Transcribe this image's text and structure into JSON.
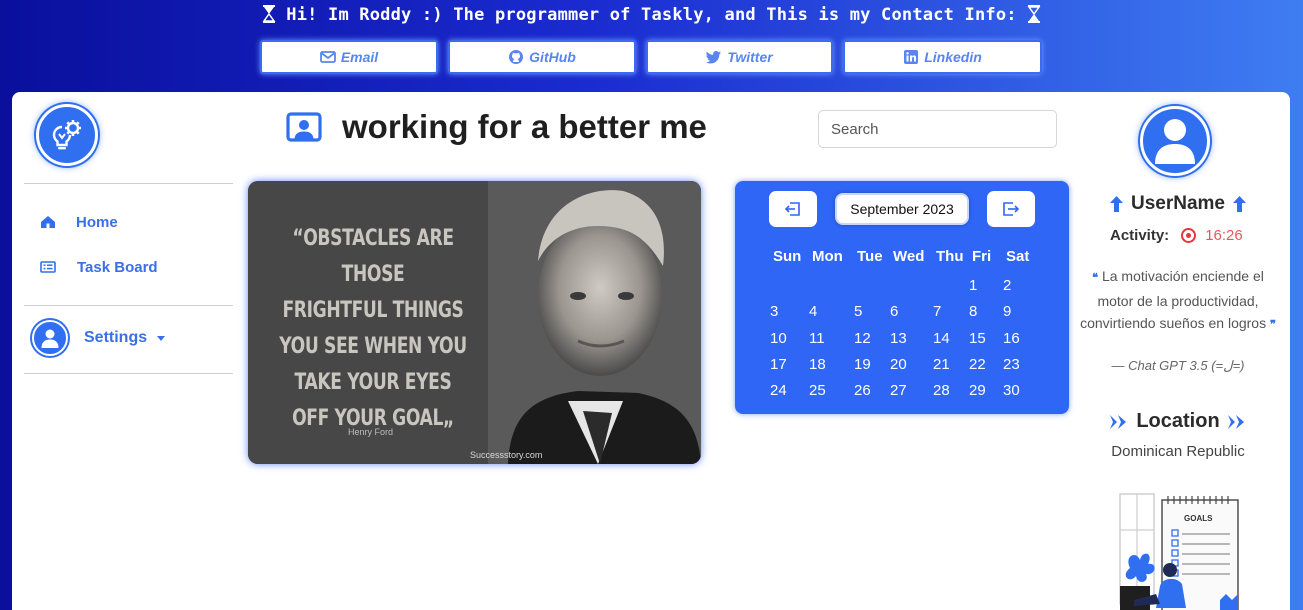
{
  "banner": {
    "title": "Hi! Im Roddy :) The programmer of Taskly, and This is my Contact Info:",
    "contacts": [
      {
        "label": "Email",
        "icon": "envelope-icon"
      },
      {
        "label": "GitHub",
        "icon": "github-icon"
      },
      {
        "label": "Twitter",
        "icon": "twitter-icon"
      },
      {
        "label": "Linkedin",
        "icon": "linkedin-icon"
      }
    ]
  },
  "sidebar": {
    "logo_icon": "lightbulb-gear-icon",
    "items": [
      {
        "label": "Home",
        "icon": "home-icon"
      },
      {
        "label": "Task Board",
        "icon": "board-icon"
      }
    ],
    "settings_label": "Settings"
  },
  "header": {
    "title": "working for a better me",
    "title_icon": "user-presentation-icon",
    "search_placeholder": "Search"
  },
  "quote_image": {
    "lines": [
      "OBSTACLES ARE THOSE",
      "FRIGHTFUL THINGS",
      "YOU SEE WHEN YOU",
      "TAKE YOUR EYES",
      "OFF YOUR GOAL"
    ],
    "open_mark": "“",
    "close_mark": "„",
    "author": "Henry Ford",
    "site": "Successstory.com"
  },
  "calendar": {
    "month_label": "September 2023",
    "prev_icon": "arrow-left-exit-icon",
    "next_icon": "arrow-right-exit-icon",
    "weekdays": [
      "Sun",
      "Mon",
      "Tue",
      "Wed",
      "Thu",
      "Fri",
      "Sat"
    ],
    "first_weekday_index": 5,
    "days_in_month": 30
  },
  "profile": {
    "username": "UserName",
    "activity_label": "Activity:",
    "timer": "16:26",
    "motivation": "La motivación enciende el motor de la productividad, convirtiendo sueños en logros",
    "motivation_open": "❝",
    "motivation_close": "❞",
    "motivation_source": "— Chat GPT 3.5 (=ل=)",
    "location_title": "Location",
    "location_value": "Dominican Republic",
    "goals_label": "GOALS"
  },
  "colors": {
    "accent": "#2f6ff0",
    "calendar_bg": "#2f66f5",
    "timer": "#e8565c"
  }
}
